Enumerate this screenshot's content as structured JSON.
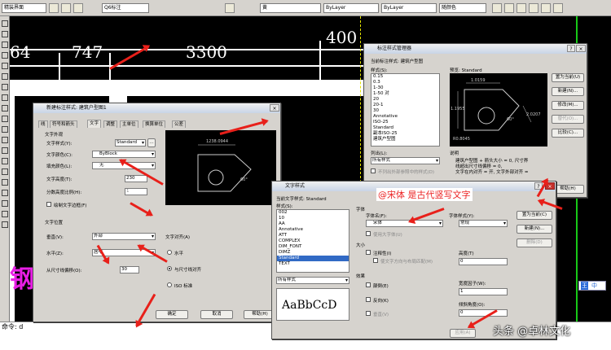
{
  "toolbar": {
    "workspace": "精装界面",
    "dimstyle": "Q6标注",
    "color": "黄",
    "linetype": "ByLayer",
    "lineweight": "ByLayer",
    "plotstyle": "随颜色"
  },
  "drawing": {
    "dims": [
      "64",
      "747",
      "3300",
      "400"
    ],
    "pink_text": "钢"
  },
  "command": {
    "prompt": "命令: d"
  },
  "manager": {
    "title": "标注样式管理器",
    "current_label": "当前标注样式: 建筑户型图",
    "styles_label": "样式(S):",
    "styles": [
      "0.15",
      "0.3",
      "1-30",
      "1-50 对",
      "20",
      "20-1",
      "30",
      "Annotative",
      "ISO-25",
      "Standard",
      "副本ISO-25",
      "建筑户型图"
    ],
    "preview_label": "预览: Standard",
    "list_label": "列出(L):",
    "list_value": "所有样式",
    "no_xref": "不列出外部参照中的样式(D)",
    "desc_label": "说明",
    "desc_lines": [
      "建筑户型图 + 箭头大小 = 0, 尺寸界",
      "线超出尺寸线偏移 = 0,",
      "文字在内对齐 = 开, 文字外部对齐 ="
    ],
    "buttons": [
      "置为当前(U)",
      "新建(N)...",
      "修改(M)...",
      "替代(O)...",
      "比较(C)..."
    ],
    "help": "帮助(H)",
    "pv": [
      "1.0159",
      "1.1955",
      "2.0207",
      "60°",
      "R0.8045"
    ]
  },
  "newdim": {
    "title": "新建标注样式: 建筑户型图1",
    "tabs": [
      "线",
      "符号和箭头",
      "文字",
      "调整",
      "主单位",
      "换算单位",
      "公差"
    ],
    "appearance": "文字外观",
    "text_style_label": "文字样式(Y):",
    "text_style": "Standard",
    "text_color_label": "文字颜色(C):",
    "text_color": "ByBlock",
    "fill_color_label": "填充颜色(L):",
    "fill_color": "无",
    "text_height_label": "文字高度(T):",
    "text_height": "230",
    "fraction_label": "分数高度比例(H):",
    "fraction_value": "1",
    "frame_label": "绘制文字边框(F)",
    "placement": "文字位置",
    "vertical_label": "垂直(V):",
    "vertical": "外部",
    "horizontal_label": "水平(Z):",
    "horizontal": "居中",
    "offset_label": "从尺寸线偏移(O):",
    "offset": "30",
    "align": "文字对齐(A)",
    "align_opts": [
      "水平",
      "与尺寸线对齐",
      "ISO 标准"
    ],
    "buttons": [
      "确定",
      "取消",
      "帮助(H)"
    ],
    "pv": [
      "1238.0944",
      "60°"
    ]
  },
  "textstyle": {
    "title": "文字样式",
    "current": "当前文字样式: Standard",
    "styles_label": "样式(S):",
    "styles": [
      "002",
      "10",
      "AA",
      "Annotative",
      "ATT",
      "COMPLEX",
      "DIM_FONT",
      "DIMZ",
      "Standard",
      "TEXT"
    ],
    "font_group": "字体",
    "fontname_label": "字体名(F):",
    "fontname": "宋体",
    "fontstyle_label": "字体样式(Y):",
    "fontstyle": "常规",
    "bigfont": "使用大字体(U)",
    "size_group": "大小",
    "annotative": "注释性(I)",
    "match": "使文字方向与布局匹配(M)",
    "height_label": "高度(T)",
    "height": "0",
    "effects_group": "效果",
    "upside": "颠倒(E)",
    "backwards": "反向(K)",
    "vertical": "垂直(V)",
    "width_label": "宽度因子(W):",
    "width": "1",
    "oblique_label": "倾斜角度(O):",
    "oblique": "0",
    "list_value": "所有样式",
    "sample": "AaBbCcD",
    "buttons": [
      "置为当前(C)",
      "新建(N)...",
      "删除(D)"
    ],
    "apply": "应用(A)",
    "annotation": "@宋体  是古代竖写文字"
  },
  "ime": {
    "a": "王",
    "b": "中"
  },
  "watermark": "头条 @卓林文化"
}
